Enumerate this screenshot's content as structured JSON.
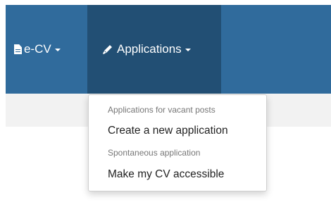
{
  "navbar": {
    "items": [
      {
        "label": "e-CV",
        "icon": "file-icon",
        "has_caret": true
      },
      {
        "label": "Applications",
        "icon": "pencil-icon",
        "has_caret": true,
        "active": true
      }
    ]
  },
  "applications_menu": {
    "sections": [
      {
        "header": "Applications for vacant posts",
        "items": [
          {
            "label": "Create a new application"
          }
        ]
      },
      {
        "header": "Spontaneous application",
        "items": [
          {
            "label": "Make my CV accessible"
          }
        ]
      }
    ]
  },
  "colors": {
    "navbar_bg": "#306b9c",
    "navbar_active_bg": "#224f74",
    "subbar_bg": "#f2f2f2",
    "menu_header_text": "#777777",
    "menu_item_text": "#222222"
  }
}
